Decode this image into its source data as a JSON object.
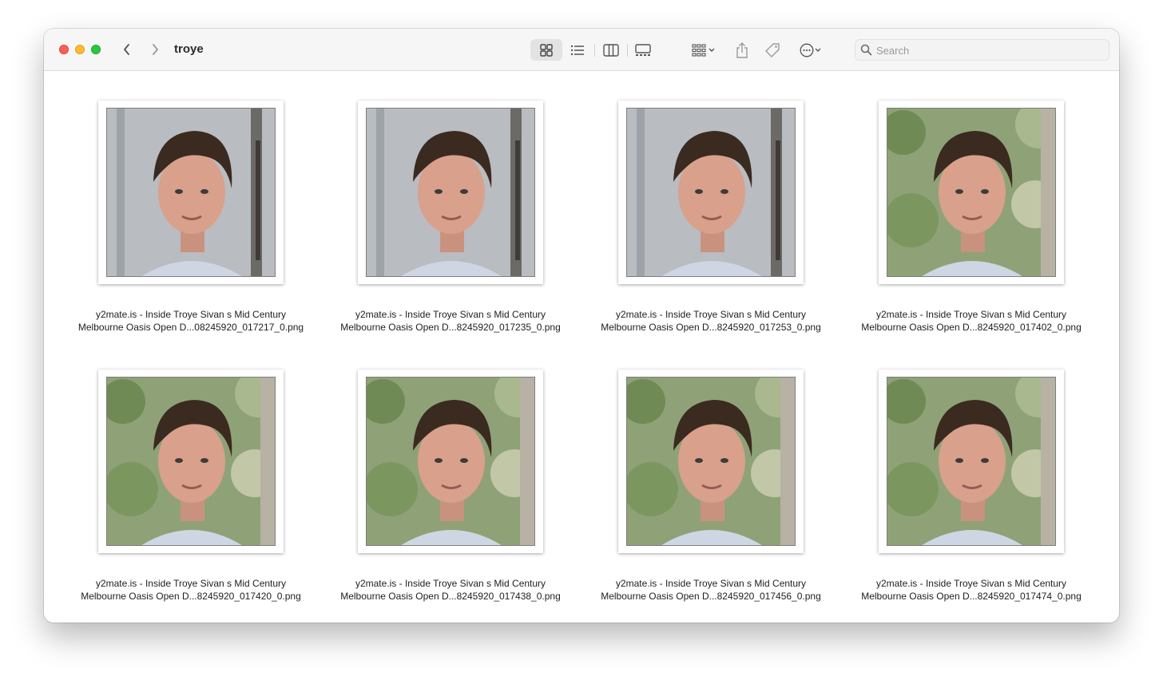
{
  "window": {
    "title": "troye",
    "toolbar": {
      "back_icon": "chevron-left-icon",
      "forward_icon": "chevron-right-icon",
      "view_buttons": [
        "icon-view",
        "list-view",
        "column-view",
        "gallery-view"
      ],
      "active_view": "icon-view",
      "group_icon": "group-grid-icon",
      "share_icon": "share-icon",
      "tag_icon": "tag-icon",
      "more_icon": "ellipsis-circle-icon"
    },
    "search": {
      "placeholder": "Search",
      "value": ""
    }
  },
  "files": [
    {
      "line1": "y2mate.is - Inside Troye Sivan s Mid Century",
      "line2": "Melbourne Oasis Open D...08245920_017217_0.png",
      "background": "wall"
    },
    {
      "line1": "y2mate.is - Inside Troye Sivan s Mid Century",
      "line2": "Melbourne Oasis Open D...8245920_017235_0.png",
      "background": "wall"
    },
    {
      "line1": "y2mate.is - Inside Troye Sivan s Mid Century",
      "line2": "Melbourne Oasis Open D...8245920_017253_0.png",
      "background": "wall"
    },
    {
      "line1": "y2mate.is - Inside Troye Sivan s Mid Century",
      "line2": "Melbourne Oasis Open D...8245920_017402_0.png",
      "background": "foliage"
    },
    {
      "line1": "y2mate.is - Inside Troye Sivan s Mid Century",
      "line2": "Melbourne Oasis Open D...8245920_017420_0.png",
      "background": "foliage"
    },
    {
      "line1": "y2mate.is - Inside Troye Sivan s Mid Century",
      "line2": "Melbourne Oasis Open D...8245920_017438_0.png",
      "background": "foliage"
    },
    {
      "line1": "y2mate.is - Inside Troye Sivan s Mid Century",
      "line2": "Melbourne Oasis Open D...8245920_017456_0.png",
      "background": "foliage"
    },
    {
      "line1": "y2mate.is - Inside Troye Sivan s Mid Century",
      "line2": "Melbourne Oasis Open D...8245920_017474_0.png",
      "background": "foliage"
    }
  ],
  "colors": {
    "close": "#fe5f57",
    "minimize": "#febc2e",
    "zoom": "#28c840",
    "toolbar_bg": "#f6f6f6",
    "wall": "#b9bcc0",
    "foliage": "#8fa277",
    "hair": "#3b2a20",
    "skin": "#d9a08c",
    "shirt": "#cfd6e3"
  }
}
